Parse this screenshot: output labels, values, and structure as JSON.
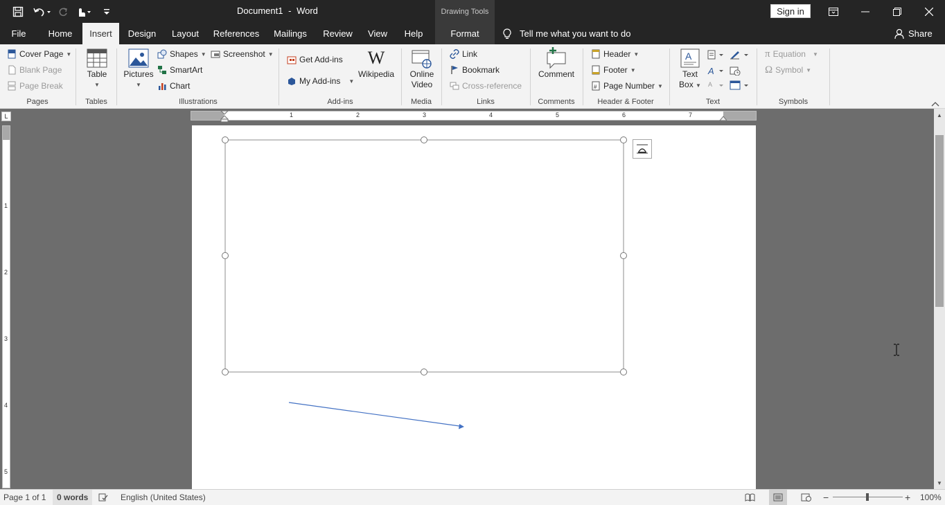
{
  "title": {
    "document": "Document1",
    "separator": "-",
    "app": "Word",
    "context_tab_group": "Drawing Tools",
    "sign_in": "Sign in"
  },
  "tabs": {
    "file": "File",
    "home": "Home",
    "insert": "Insert",
    "design": "Design",
    "layout": "Layout",
    "references": "References",
    "mailings": "Mailings",
    "review": "Review",
    "view": "View",
    "help": "Help",
    "format": "Format",
    "tell_me": "Tell me what you want to do",
    "share": "Share"
  },
  "ribbon": {
    "pages": {
      "label": "Pages",
      "cover_page": "Cover Page",
      "blank_page": "Blank Page",
      "page_break": "Page Break"
    },
    "tables": {
      "label": "Tables",
      "table": "Table"
    },
    "illustrations": {
      "label": "Illustrations",
      "pictures": "Pictures",
      "shapes": "Shapes",
      "smartart": "SmartArt",
      "chart": "Chart",
      "screenshot": "Screenshot"
    },
    "addins": {
      "label": "Add-ins",
      "get_addins": "Get Add-ins",
      "my_addins": "My Add-ins",
      "wikipedia": "Wikipedia"
    },
    "media": {
      "label": "Media",
      "online_video_line1": "Online",
      "online_video_line2": "Video"
    },
    "links": {
      "label": "Links",
      "link": "Link",
      "bookmark": "Bookmark",
      "cross_reference": "Cross-reference"
    },
    "comments": {
      "label": "Comments",
      "comment": "Comment"
    },
    "header_footer": {
      "label": "Header & Footer",
      "header": "Header",
      "footer": "Footer",
      "page_number": "Page Number"
    },
    "text": {
      "label": "Text",
      "text_box_line1": "Text",
      "text_box_line2": "Box"
    },
    "symbols": {
      "label": "Symbols",
      "equation": "Equation",
      "symbol": "Symbol"
    }
  },
  "ruler": {
    "h_numbers": [
      "1",
      "2",
      "3",
      "4",
      "5",
      "6",
      "7"
    ],
    "v_numbers": [
      "1",
      "2",
      "3",
      "4",
      "5"
    ]
  },
  "status": {
    "page": "Page 1 of 1",
    "words": "0 words",
    "language": "English (United States)",
    "zoom": "100%"
  },
  "colors": {
    "titlebar": "#252525",
    "ribbon": "#f3f3f3",
    "workspace": "#6d6d6d",
    "arrow": "#4472c4"
  }
}
